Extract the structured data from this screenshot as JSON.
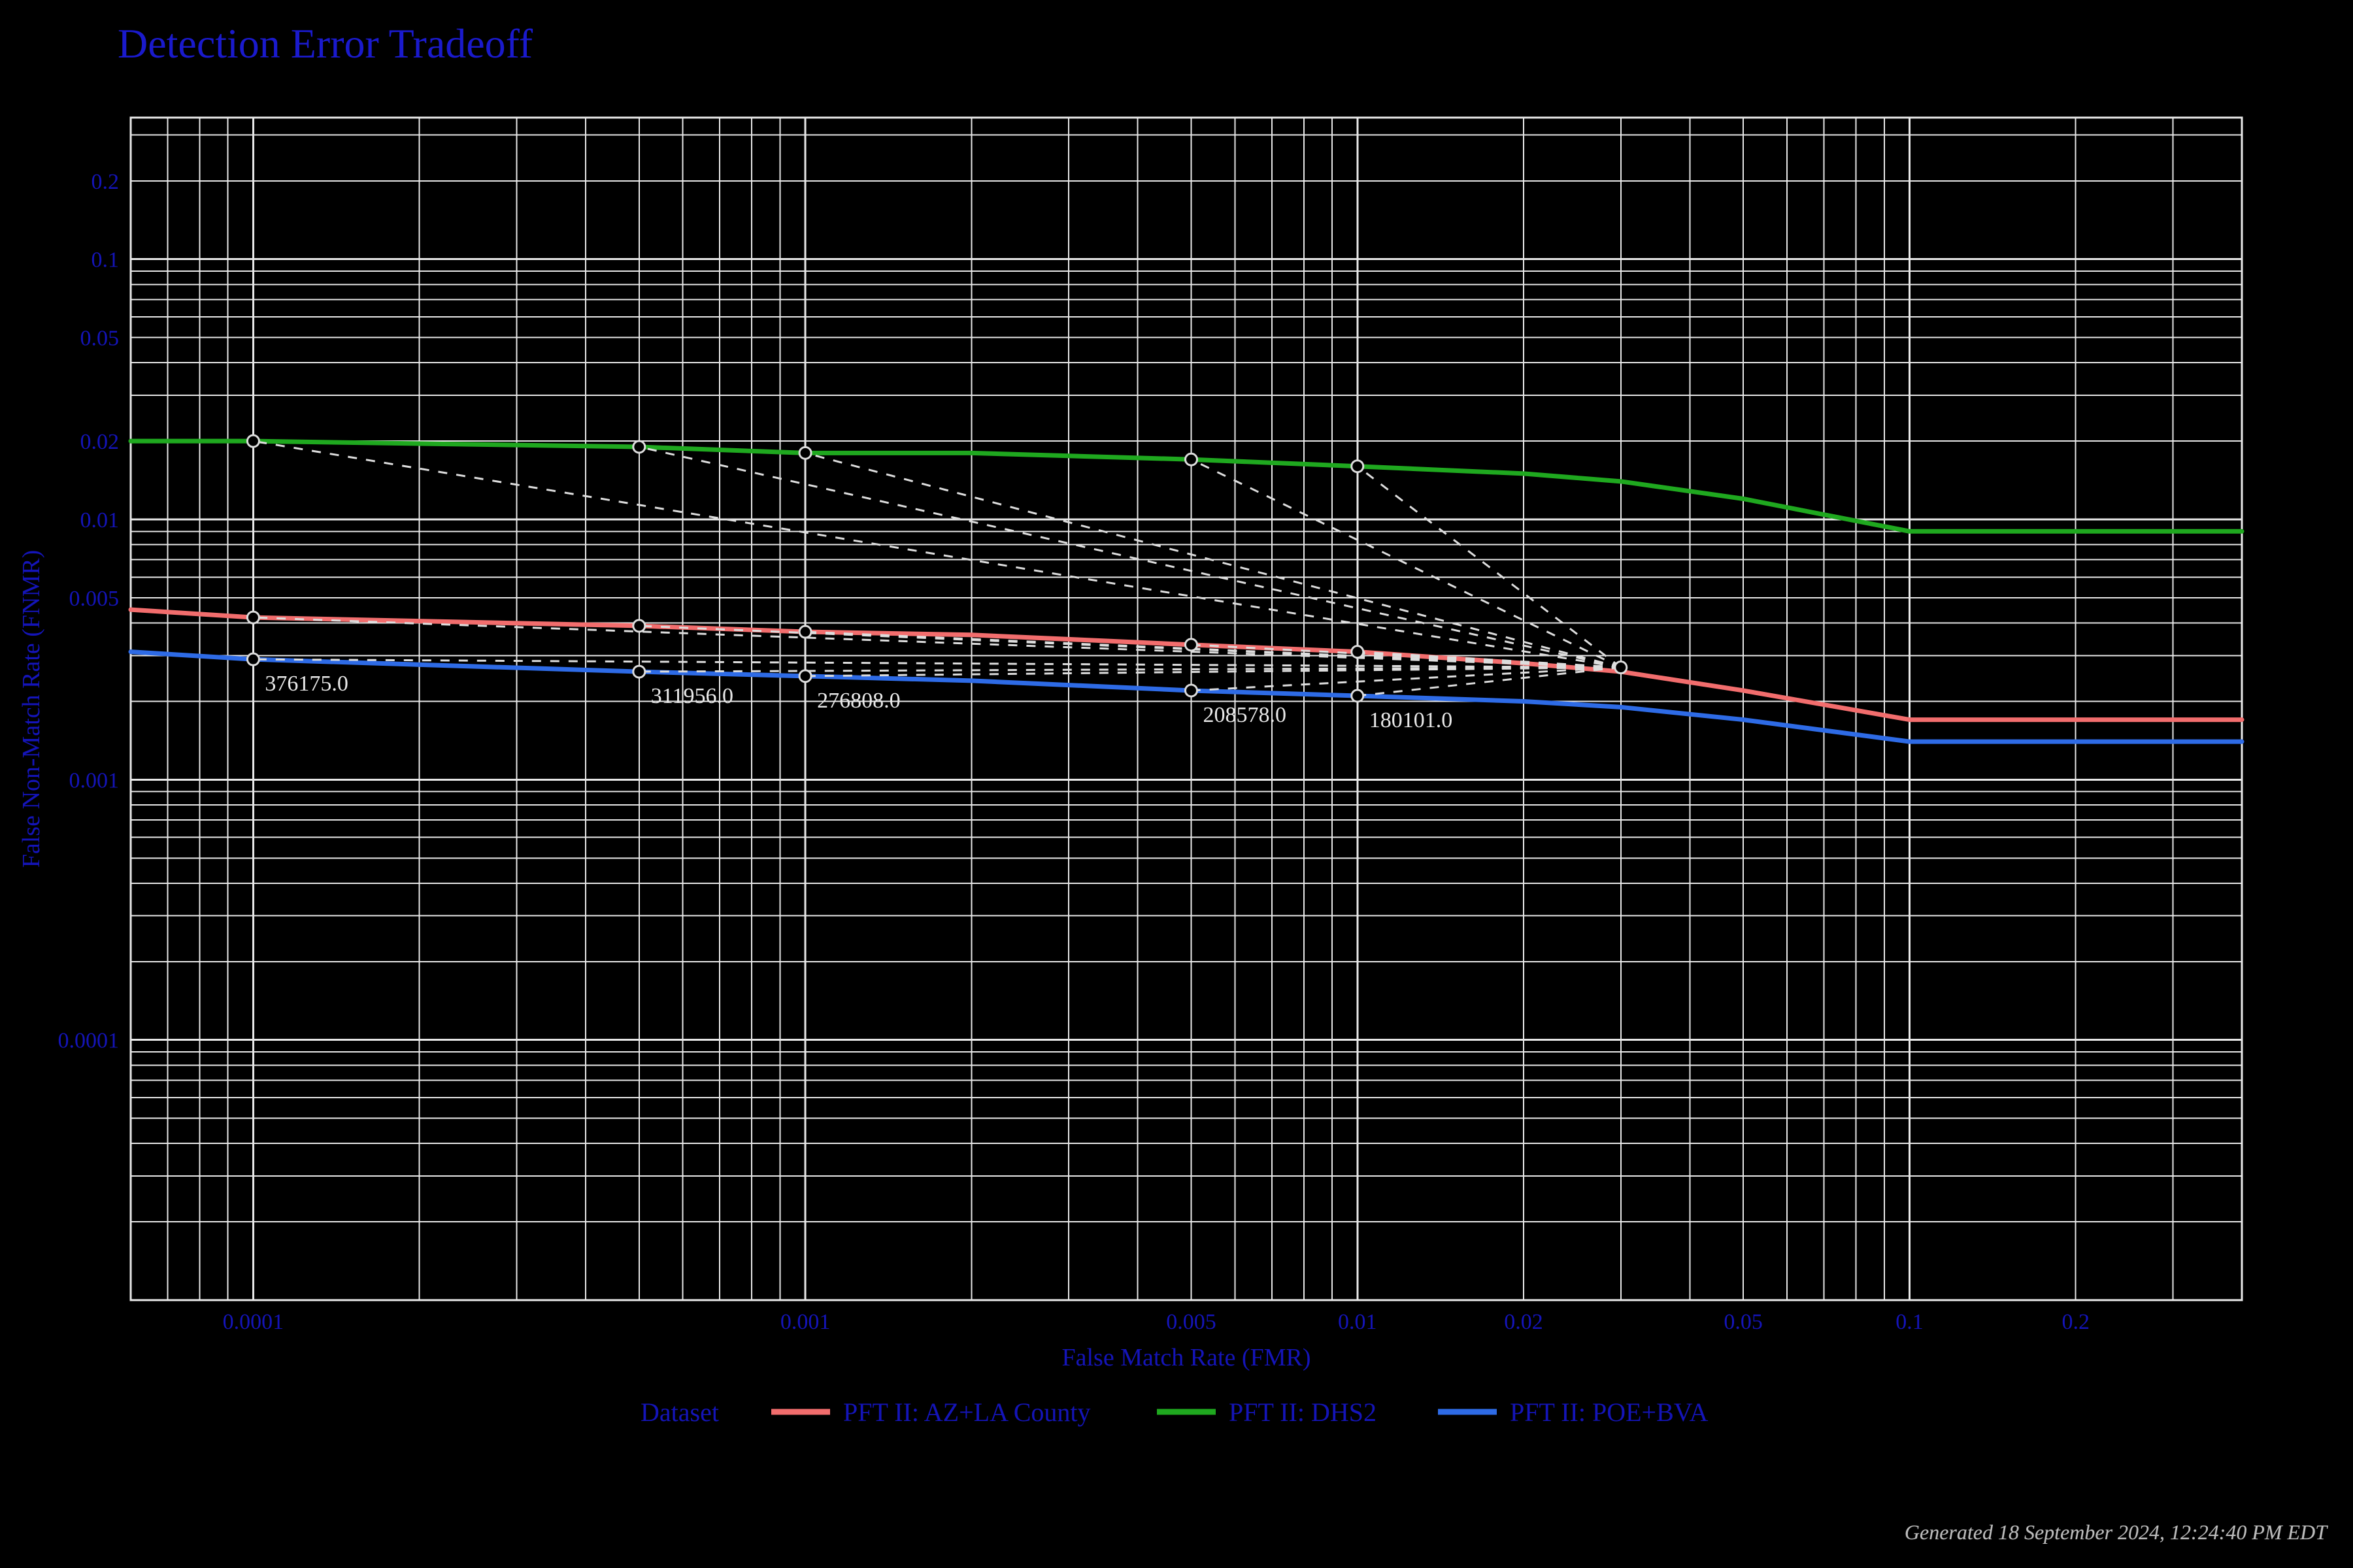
{
  "chart_data": {
    "type": "line",
    "title": "Detection Error Tradeoff",
    "xlabel": "False Match Rate (FMR)",
    "ylabel": "False Non-Match Rate (FNMR)",
    "xscale": "log",
    "yscale": "log",
    "xlim": [
      6e-05,
      0.4
    ],
    "ylim": [
      1e-05,
      0.35
    ],
    "x_ticks": [
      0.0001,
      0.001,
      0.005,
      0.01,
      0.02,
      0.05,
      0.1,
      0.2
    ],
    "y_ticks": [
      0.0001,
      0.001,
      0.005,
      0.01,
      0.02,
      0.05,
      0.1,
      0.2
    ],
    "grid": true,
    "legend_title": "Dataset",
    "legend_position": "bottom",
    "series": [
      {
        "name": "PFT II: AZ+LA County",
        "color": "#f26d6d",
        "x": [
          6e-05,
          0.0001,
          0.0005,
          0.001,
          0.002,
          0.005,
          0.01,
          0.02,
          0.03,
          0.05,
          0.1,
          0.2,
          0.4
        ],
        "y": [
          0.0045,
          0.0042,
          0.0039,
          0.0037,
          0.0036,
          0.0033,
          0.0031,
          0.0028,
          0.0026,
          0.0022,
          0.0017,
          0.0017,
          0.0017
        ]
      },
      {
        "name": "PFT II: DHS2",
        "color": "#1fa81f",
        "x": [
          6e-05,
          0.0001,
          0.0005,
          0.001,
          0.002,
          0.005,
          0.01,
          0.02,
          0.03,
          0.05,
          0.1,
          0.2,
          0.4
        ],
        "y": [
          0.02,
          0.02,
          0.019,
          0.018,
          0.018,
          0.017,
          0.016,
          0.015,
          0.014,
          0.012,
          0.009,
          0.009,
          0.009
        ]
      },
      {
        "name": "PFT II: POE+BVA",
        "color": "#2e6be6",
        "x": [
          6e-05,
          0.0001,
          0.0005,
          0.001,
          0.002,
          0.005,
          0.01,
          0.02,
          0.03,
          0.05,
          0.1,
          0.2,
          0.4
        ],
        "y": [
          0.0031,
          0.0029,
          0.0026,
          0.0025,
          0.0024,
          0.0022,
          0.0021,
          0.002,
          0.0019,
          0.0017,
          0.0014,
          0.0014,
          0.0014
        ]
      }
    ],
    "threshold_points": {
      "note": "Labeled operating-threshold points; each label has one point on each series at a shared FMR, joined by dashed connectors.",
      "labels": [
        "376175.0",
        "311956.0",
        "276808.0",
        "208578.0",
        "180101.0"
      ],
      "fmr": [
        0.0001,
        0.0005,
        0.001,
        0.005,
        0.01
      ],
      "per_series_fnmr": {
        "PFT II: AZ+LA County": [
          0.0042,
          0.0039,
          0.0037,
          0.0033,
          0.0031
        ],
        "PFT II: DHS2": [
          0.02,
          0.019,
          0.018,
          0.017,
          0.016
        ],
        "PFT II: POE+BVA": [
          0.0029,
          0.0026,
          0.0025,
          0.0022,
          0.0021
        ]
      },
      "label_anchor_series": "PFT II: POE+BVA",
      "connector_hub": {
        "fmr": 0.03,
        "fnmr": 0.0027
      }
    }
  },
  "footer": {
    "generated": "Generated 18 September 2024, 12:24:40 PM EDT"
  }
}
